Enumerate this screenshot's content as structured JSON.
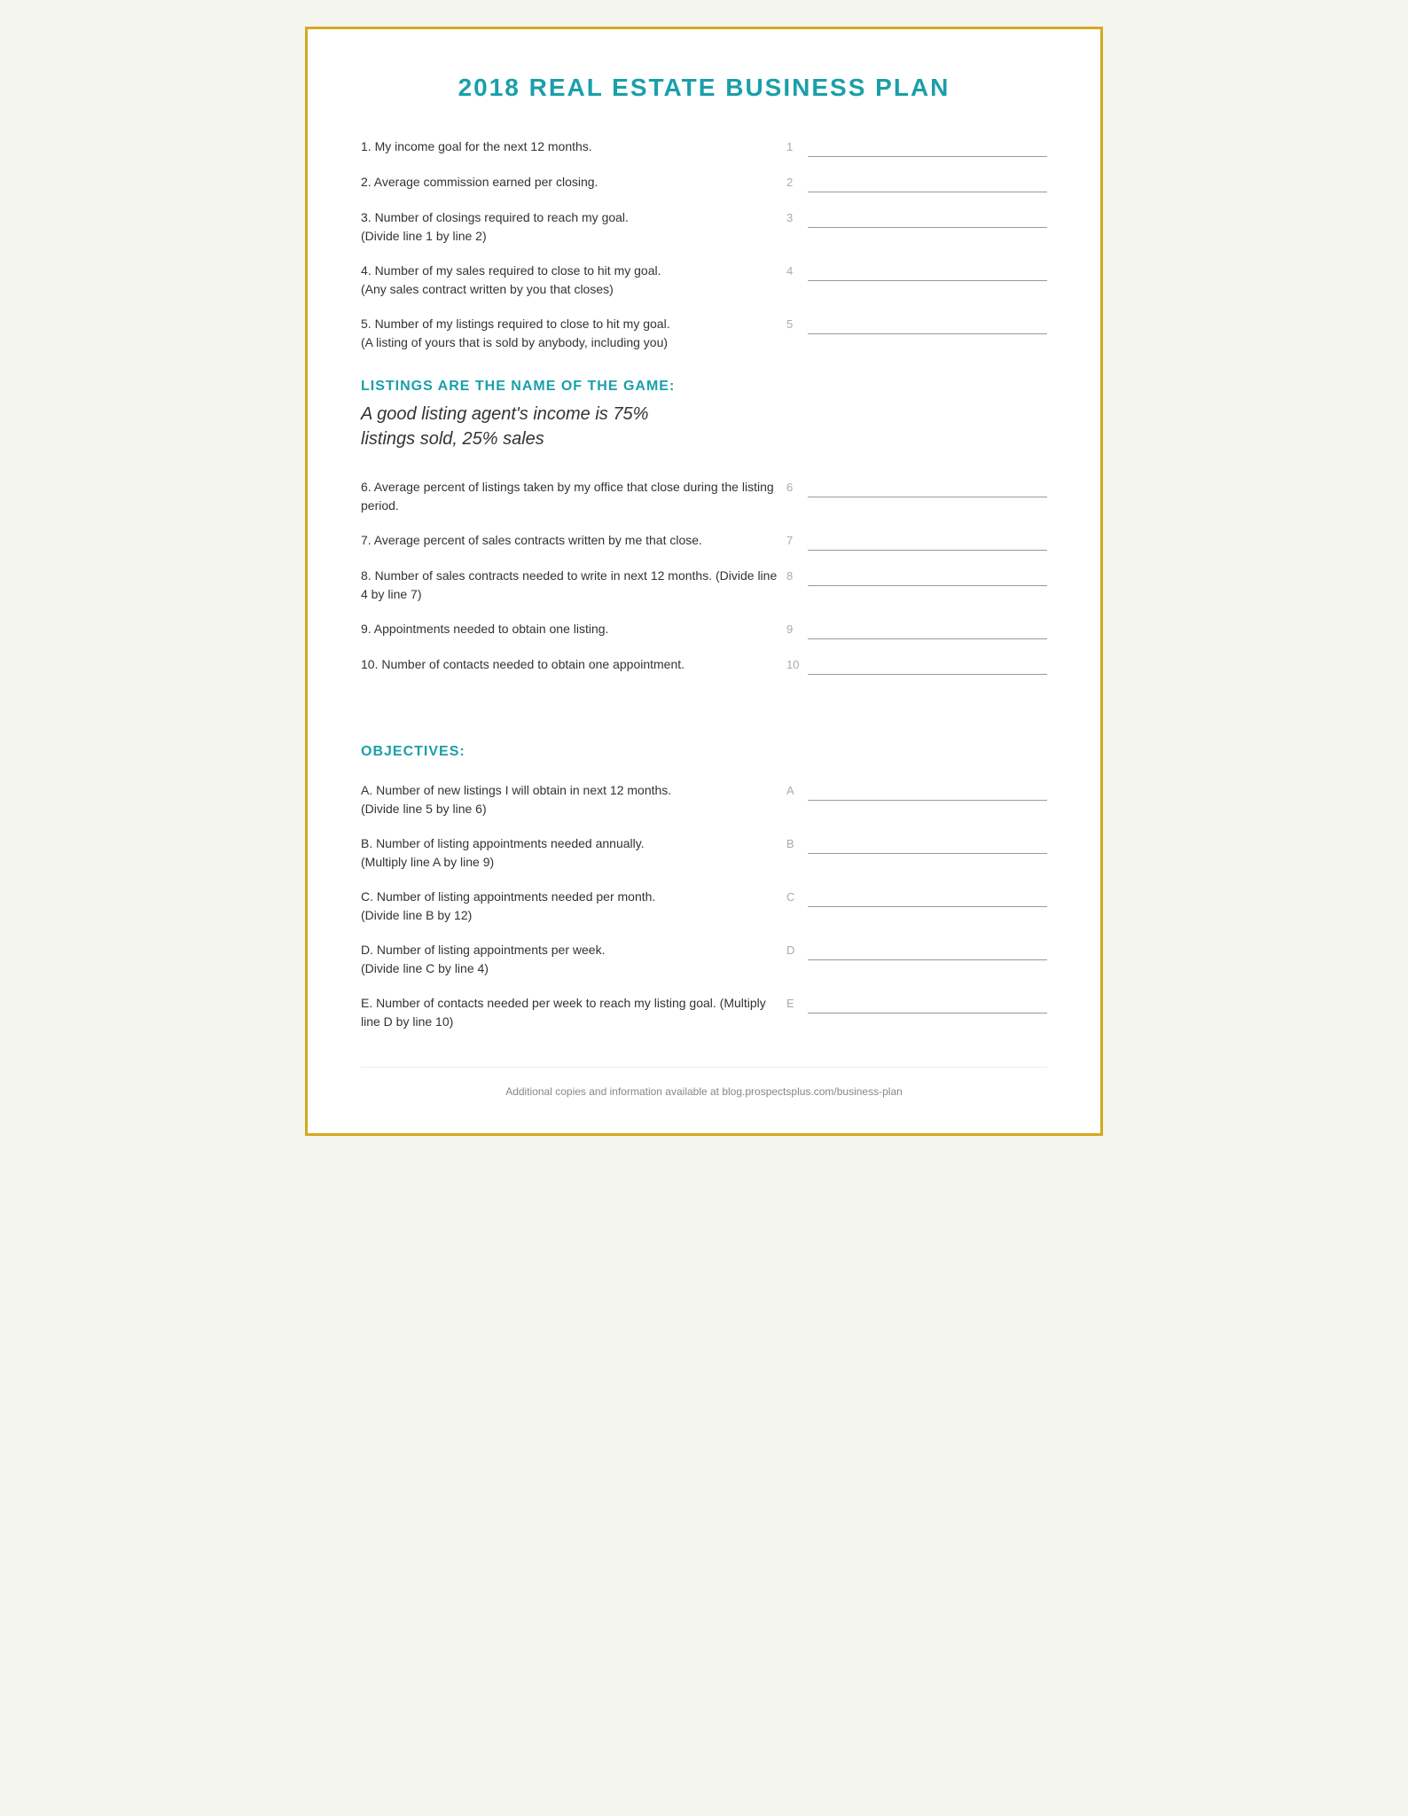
{
  "page": {
    "title": "2018 REAL ESTATE BUSINESS PLAN",
    "border_color": "#d4a820",
    "accent_color": "#1a9faa"
  },
  "questions": [
    {
      "id": "q1",
      "number": "1",
      "label": "1",
      "text": "1. My income goal for the next 12 months."
    },
    {
      "id": "q2",
      "number": "2",
      "label": "2",
      "text": "2. Average commission earned per closing."
    },
    {
      "id": "q3",
      "number": "3",
      "label": "3",
      "text": "3. Number of closings required to reach my goal.\n(Divide line 1 by line 2)"
    },
    {
      "id": "q4",
      "number": "4",
      "label": "4",
      "text": "4. Number of my sales required to close to hit my goal.\n(Any sales contract written by you that closes)"
    },
    {
      "id": "q5",
      "number": "5",
      "label": "5",
      "text": "5. Number of my listings required to close to hit my goal.\n(A listing of yours that is sold by anybody, including you)"
    }
  ],
  "section1": {
    "heading": "LISTINGS ARE THE NAME OF THE GAME:",
    "italic_line1": "A good listing agent's income is 75%",
    "italic_line2": "listings sold, 25% sales"
  },
  "questions2": [
    {
      "id": "q6",
      "number": "6",
      "label": "6",
      "text": "6. Average percent of listings taken by my office that close during the listing period."
    },
    {
      "id": "q7",
      "number": "7",
      "label": "7",
      "text": "7. Average percent of sales contracts written by me that close."
    },
    {
      "id": "q8",
      "number": "8",
      "label": "8",
      "text": "8. Number of sales contracts needed to write in next 12 months. (Divide line 4 by line 7)"
    },
    {
      "id": "q9",
      "number": "9",
      "label": "9",
      "text": "9. Appointments needed to obtain one listing."
    },
    {
      "id": "q10",
      "number": "10",
      "label": "10",
      "text": "10. Number of contacts needed to obtain one appointment."
    }
  ],
  "section2": {
    "heading": "OBJECTIVES:"
  },
  "objectives": [
    {
      "id": "objA",
      "label": "A",
      "text": "A. Number of new listings I will obtain in next 12 months.\n(Divide line 5 by line 6)"
    },
    {
      "id": "objB",
      "label": "B",
      "text": "B. Number of listing appointments needed annually.\n(Multiply line A by line 9)"
    },
    {
      "id": "objC",
      "label": "C",
      "text": "C. Number of listing appointments needed per month.\n(Divide line B by 12)"
    },
    {
      "id": "objD",
      "label": "D",
      "text": "D. Number of listing appointments per week.\n(Divide line C by line 4)"
    },
    {
      "id": "objE",
      "label": "E",
      "text": "E. Number of contacts needed per week to reach my listing goal. (Multiply line D by line 10)"
    }
  ],
  "footer": {
    "text": "Additional copies and information available at blog.prospectsplus.com/business-plan"
  }
}
